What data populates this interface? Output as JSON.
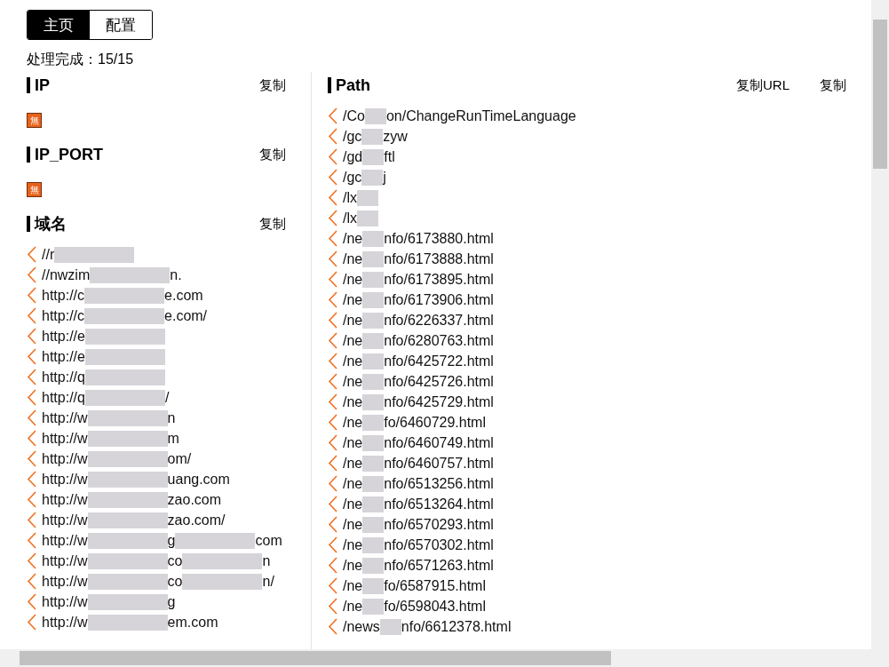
{
  "tabs": [
    {
      "label": "主页",
      "selected": true
    },
    {
      "label": "配置",
      "selected": false
    }
  ],
  "status": "处理完成：15/15",
  "left_sections": [
    {
      "title": "IP",
      "actions": [
        "复制"
      ],
      "empty_mark": "無"
    },
    {
      "title": "IP_PORT",
      "actions": [
        "复制"
      ],
      "empty_mark": "無"
    },
    {
      "title": "域名",
      "actions": [
        "复制"
      ],
      "items": [
        {
          "parts": [
            "//r"
          ]
        },
        {
          "parts": [
            "//nwzim",
            "n."
          ]
        },
        {
          "parts": [
            "http://c",
            "e.com"
          ]
        },
        {
          "parts": [
            "http://c",
            "e.com/"
          ]
        },
        {
          "parts": [
            "http://e"
          ]
        },
        {
          "parts": [
            "http://e"
          ]
        },
        {
          "parts": [
            "http://q"
          ]
        },
        {
          "parts": [
            "http://q",
            "/"
          ]
        },
        {
          "parts": [
            "http://w",
            "n"
          ]
        },
        {
          "parts": [
            "http://w",
            "m"
          ]
        },
        {
          "parts": [
            "http://w",
            "om/"
          ]
        },
        {
          "parts": [
            "http://w",
            "uang.com"
          ]
        },
        {
          "parts": [
            "http://w",
            "zao.com"
          ]
        },
        {
          "parts": [
            "http://w",
            "zao.com/"
          ]
        },
        {
          "parts": [
            "http://w",
            "g",
            "com"
          ]
        },
        {
          "parts": [
            "http://w",
            "co",
            "n"
          ]
        },
        {
          "parts": [
            "http://w",
            "co",
            "n/"
          ]
        },
        {
          "parts": [
            "http://w",
            "g"
          ]
        },
        {
          "parts": [
            "http://w",
            "em.com"
          ]
        }
      ]
    }
  ],
  "path_section": {
    "title": "Path",
    "actions": [
      "复制URL",
      "复制"
    ],
    "items": [
      {
        "parts": [
          "/Co",
          "on/ChangeRunTimeLanguage"
        ]
      },
      {
        "parts": [
          "/gc",
          "zyw"
        ]
      },
      {
        "parts": [
          "/gd",
          "ftl"
        ]
      },
      {
        "parts": [
          "/gc",
          "j"
        ]
      },
      {
        "parts": [
          "/lx"
        ]
      },
      {
        "parts": [
          "/lx"
        ]
      },
      {
        "parts": [
          "/ne",
          "nfo/6173880.html"
        ]
      },
      {
        "parts": [
          "/ne",
          "nfo/6173888.html"
        ]
      },
      {
        "parts": [
          "/ne",
          "nfo/6173895.html"
        ]
      },
      {
        "parts": [
          "/ne",
          "nfo/6173906.html"
        ]
      },
      {
        "parts": [
          "/ne",
          "nfo/6226337.html"
        ]
      },
      {
        "parts": [
          "/ne",
          "nfo/6280763.html"
        ]
      },
      {
        "parts": [
          "/ne",
          "nfo/6425722.html"
        ]
      },
      {
        "parts": [
          "/ne",
          "nfo/6425726.html"
        ]
      },
      {
        "parts": [
          "/ne",
          "nfo/6425729.html"
        ]
      },
      {
        "parts": [
          "/ne",
          "fo/6460729.html"
        ]
      },
      {
        "parts": [
          "/ne",
          "nfo/6460749.html"
        ]
      },
      {
        "parts": [
          "/ne",
          "nfo/6460757.html"
        ]
      },
      {
        "parts": [
          "/ne",
          "nfo/6513256.html"
        ]
      },
      {
        "parts": [
          "/ne",
          "nfo/6513264.html"
        ]
      },
      {
        "parts": [
          "/ne",
          "nfo/6570293.html"
        ]
      },
      {
        "parts": [
          "/ne",
          "nfo/6570302.html"
        ]
      },
      {
        "parts": [
          "/ne",
          "nfo/6571263.html"
        ]
      },
      {
        "parts": [
          "/ne",
          "fo/6587915.html"
        ]
      },
      {
        "parts": [
          "/ne",
          "fo/6598043.html"
        ]
      },
      {
        "parts": [
          "/news",
          "nfo/6612378.html"
        ]
      }
    ]
  }
}
